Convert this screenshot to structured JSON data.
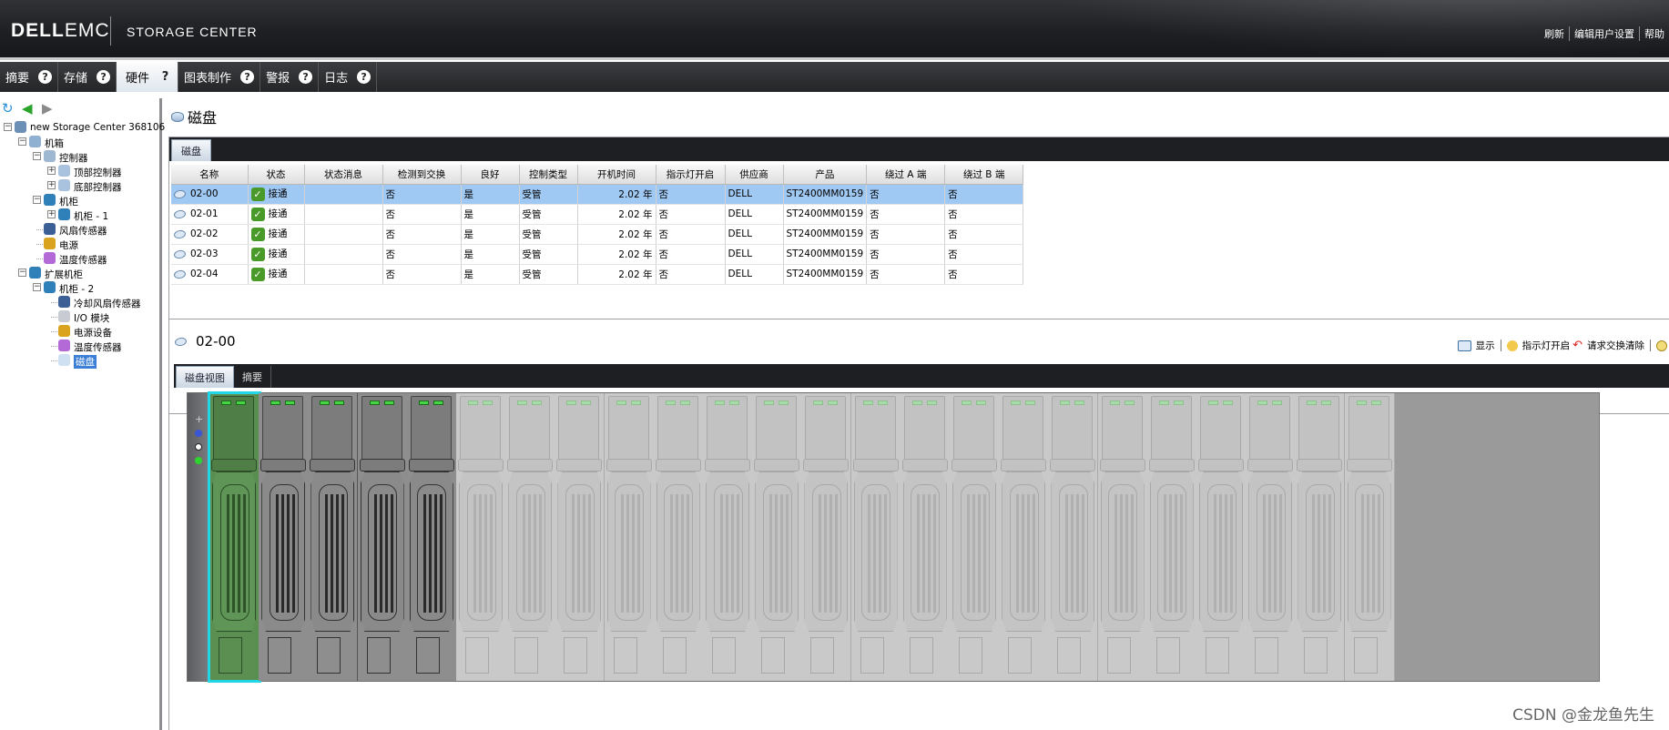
{
  "header": {
    "logo_dell": "DELL",
    "logo_emc": "EMC",
    "product": "STORAGE CENTER",
    "links": [
      "刷新",
      "编辑用户设置",
      "帮助"
    ]
  },
  "menu": {
    "tabs": [
      {
        "label": "摘要",
        "active": false
      },
      {
        "label": "存储",
        "active": false
      },
      {
        "label": "硬件",
        "active": true
      },
      {
        "label": "图表制作",
        "active": false
      },
      {
        "label": "警报",
        "active": false
      },
      {
        "label": "日志",
        "active": false
      }
    ],
    "help_glyph": "?"
  },
  "tree": {
    "items": [
      {
        "label": "new Storage Center 368106",
        "level": 0,
        "icon": "storage-center-icon",
        "expander": "−"
      },
      {
        "label": "机箱",
        "level": 1,
        "icon": "chassis-icon",
        "expander": "−"
      },
      {
        "label": "控制器",
        "level": 2,
        "icon": "controller-group-icon",
        "expander": "−"
      },
      {
        "label": "顶部控制器",
        "level": 3,
        "icon": "controller-icon",
        "expander": "+"
      },
      {
        "label": "底部控制器",
        "level": 3,
        "icon": "controller-icon",
        "expander": "+"
      },
      {
        "label": "机柜",
        "level": 2,
        "icon": "enclosure-icon",
        "expander": "−"
      },
      {
        "label": "机柜 - 1",
        "level": 3,
        "icon": "enclosure-icon",
        "expander": "+"
      },
      {
        "label": "风扇传感器",
        "level": 2,
        "icon": "fan-icon",
        "expander": ""
      },
      {
        "label": "电源",
        "level": 2,
        "icon": "power-plug-icon",
        "expander": ""
      },
      {
        "label": "温度传感器",
        "level": 2,
        "icon": "thermometer-icon",
        "expander": ""
      },
      {
        "label": "扩展机柜",
        "level": 1,
        "icon": "enclosure-icon",
        "expander": "−"
      },
      {
        "label": "机柜 - 2",
        "level": 2,
        "icon": "enclosure-icon",
        "expander": "−"
      },
      {
        "label": "冷却风扇传感器",
        "level": 3,
        "icon": "fan-icon",
        "expander": ""
      },
      {
        "label": "I/O 模块",
        "level": 3,
        "icon": "io-module-icon",
        "expander": ""
      },
      {
        "label": "电源设备",
        "level": 3,
        "icon": "power-plug-icon",
        "expander": ""
      },
      {
        "label": "温度传感器",
        "level": 3,
        "icon": "thermometer-icon",
        "expander": ""
      },
      {
        "label": "磁盘",
        "level": 3,
        "icon": "disk-icon",
        "expander": "",
        "selected": true
      }
    ]
  },
  "disks_panel": {
    "title": "磁盘",
    "tab": "磁盘",
    "columns": [
      "名称",
      "状态",
      "状态消息",
      "检测到交换",
      "良好",
      "控制类型",
      "开机时间",
      "指示灯开启",
      "供应商",
      "产品",
      "绕过 A 端",
      "绕过 B 端"
    ],
    "rows": [
      {
        "name": "02-00",
        "status": "接通",
        "status_msg": "",
        "swap": "否",
        "healthy": "是",
        "control": "受管",
        "uptime": "2.02 年",
        "indicator": "否",
        "vendor": "DELL",
        "product": "ST2400MM0159",
        "bypass_a": "否",
        "bypass_b": "否",
        "selected": true
      },
      {
        "name": "02-01",
        "status": "接通",
        "status_msg": "",
        "swap": "否",
        "healthy": "是",
        "control": "受管",
        "uptime": "2.02 年",
        "indicator": "否",
        "vendor": "DELL",
        "product": "ST2400MM0159",
        "bypass_a": "否",
        "bypass_b": "否"
      },
      {
        "name": "02-02",
        "status": "接通",
        "status_msg": "",
        "swap": "否",
        "healthy": "是",
        "control": "受管",
        "uptime": "2.02 年",
        "indicator": "否",
        "vendor": "DELL",
        "product": "ST2400MM0159",
        "bypass_a": "否",
        "bypass_b": "否"
      },
      {
        "name": "02-03",
        "status": "接通",
        "status_msg": "",
        "swap": "否",
        "healthy": "是",
        "control": "受管",
        "uptime": "2.02 年",
        "indicator": "否",
        "vendor": "DELL",
        "product": "ST2400MM0159",
        "bypass_a": "否",
        "bypass_b": "否"
      },
      {
        "name": "02-04",
        "status": "接通",
        "status_msg": "",
        "swap": "否",
        "healthy": "是",
        "control": "受管",
        "uptime": "2.02 年",
        "indicator": "否",
        "vendor": "DELL",
        "product": "ST2400MM0159",
        "bypass_a": "否",
        "bypass_b": "否"
      }
    ]
  },
  "detail_panel": {
    "title": "02-00",
    "actions": [
      "显示",
      "指示灯开启",
      "请求交换清除"
    ],
    "tabs": [
      {
        "label": "磁盘视图",
        "active": true
      },
      {
        "label": "摘要",
        "active": false
      }
    ]
  },
  "enclosure": {
    "bay_count": 24,
    "bays": [
      {
        "state": "selected"
      },
      {
        "state": "installed"
      },
      {
        "state": "installed"
      },
      {
        "state": "installed"
      },
      {
        "state": "installed"
      },
      {
        "state": "empty"
      },
      {
        "state": "empty"
      },
      {
        "state": "empty"
      },
      {
        "state": "empty"
      },
      {
        "state": "empty"
      },
      {
        "state": "empty"
      },
      {
        "state": "empty"
      },
      {
        "state": "empty"
      },
      {
        "state": "empty"
      },
      {
        "state": "empty"
      },
      {
        "state": "empty"
      },
      {
        "state": "empty"
      },
      {
        "state": "empty"
      },
      {
        "state": "empty"
      },
      {
        "state": "empty"
      },
      {
        "state": "empty"
      },
      {
        "state": "empty"
      },
      {
        "state": "empty"
      },
      {
        "state": "empty"
      }
    ],
    "colors": {
      "selected_outline": "#21d7e7",
      "selected_fill": "#5b8f52",
      "led_green": "#46d446"
    }
  },
  "watermark": "CSDN @金龙鱼先生"
}
